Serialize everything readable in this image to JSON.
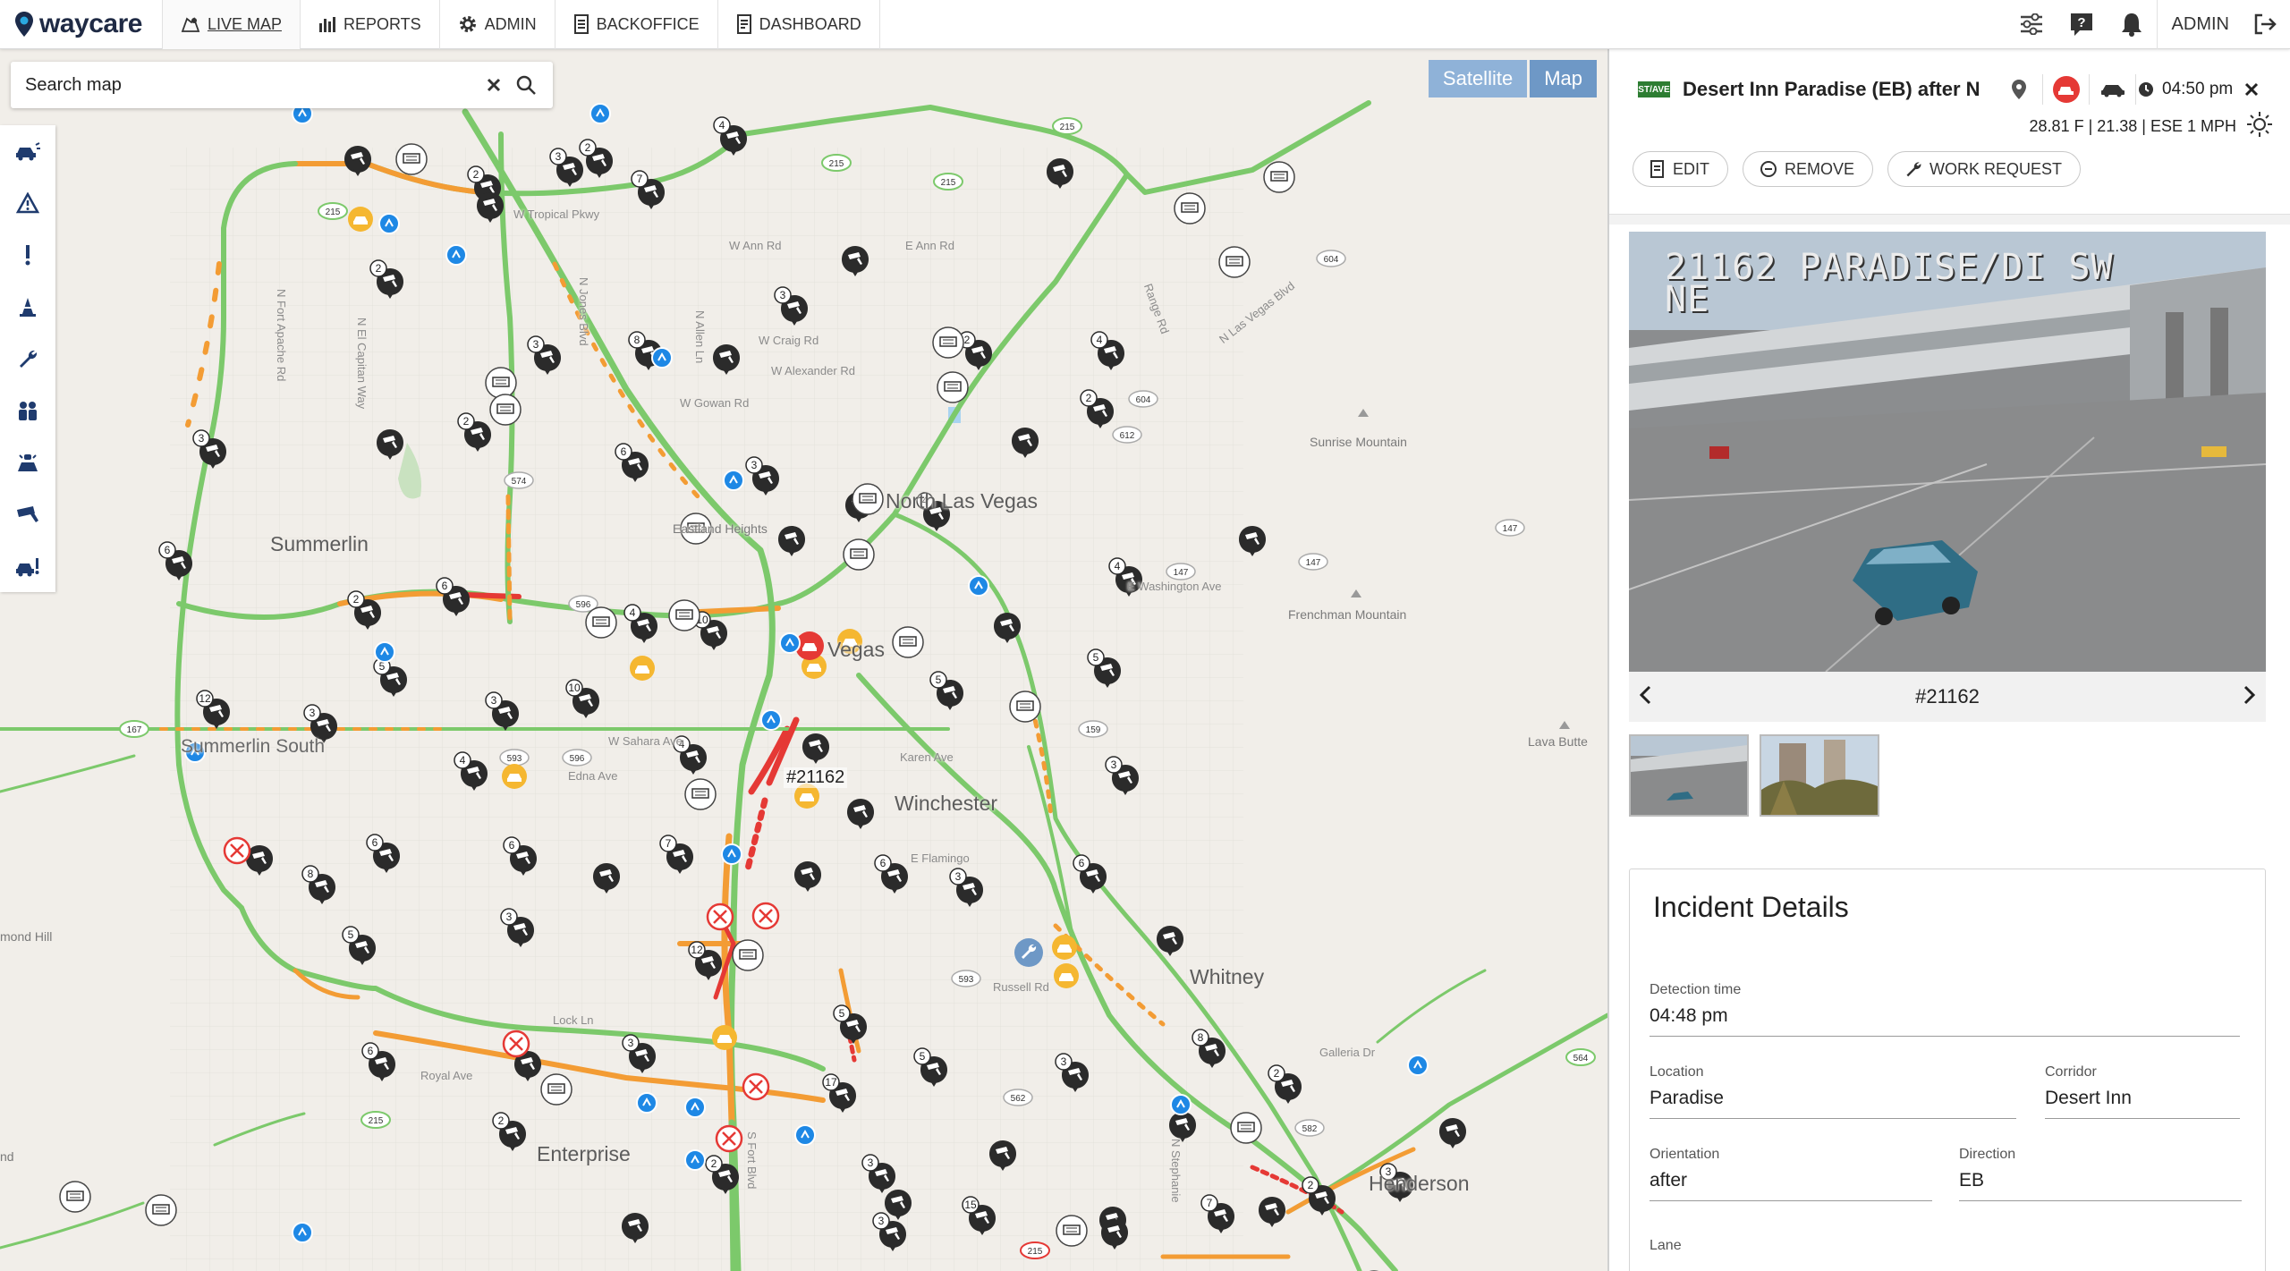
{
  "app": {
    "logo_text": "waycare",
    "nav": [
      {
        "label": "LIVE MAP",
        "icon": "live-map-icon",
        "active": true
      },
      {
        "label": "REPORTS",
        "icon": "bar-chart-icon"
      },
      {
        "label": "ADMIN",
        "icon": "gear-icon"
      },
      {
        "label": "BACKOFFICE",
        "icon": "document-icon"
      },
      {
        "label": "DASHBOARD",
        "icon": "dashboard-icon"
      }
    ],
    "user_label": "ADMIN"
  },
  "map": {
    "search_placeholder": "Search map",
    "map_types": [
      "Satellite",
      "Map"
    ],
    "selected_map_type": "Map",
    "tools": [
      "crash-layer-icon",
      "hazard-layer-icon",
      "alert-layer-icon",
      "cone-layer-icon",
      "wrench-layer-icon",
      "people-layer-icon",
      "police-layer-icon",
      "camera-layer-icon",
      "vehicle-alert-layer-icon"
    ],
    "area_labels": [
      "North Las Vegas",
      "Summerlin",
      "Summerlin South",
      "Winchester",
      "Whitney",
      "Enterprise",
      "Henderson",
      "Vegas",
      "Sunrise Mountain",
      "Frenchman Mountain",
      "Lava Butte",
      "Eastland Heights",
      "mond Hill",
      "nd"
    ],
    "street_labels": [
      "W Tropical Pkwy",
      "W Ann Rd",
      "E Ann Rd",
      "W Craig Rd",
      "W Alexander Rd",
      "W Gowan Rd",
      "N Fort Apache Rd",
      "N El Capitan Way",
      "N Jones Blvd",
      "N Allen Ln",
      "Range Rd",
      "N Las Vegas Blvd",
      "E Washington Ave",
      "W Sahara Ave",
      "Edna Ave",
      "Karen Ave",
      "Russell Rd",
      "Galleria Dr",
      "Royal Ave",
      "Lock Ln",
      "N Stephanie",
      "S Fort Blvd",
      "E Flamingo"
    ],
    "incident_tag": "#21162"
  },
  "panel": {
    "badge": "ST/AVE",
    "title": "Desert Inn Paradise (EB) after N",
    "time": "04:50 pm",
    "weather": "28.81 F | 21.38 | ESE 1 MPH",
    "actions": {
      "edit": "EDIT",
      "remove": "REMOVE",
      "work_request": "WORK REQUEST"
    },
    "camera": {
      "overlay_line1": "21162 PARADISE/DI SW",
      "overlay_line2": "NE",
      "id": "#21162"
    },
    "details": {
      "heading": "Incident Details",
      "detection_time_label": "Detection time",
      "detection_time": "04:48 pm",
      "location_label": "Location",
      "location": "Paradise",
      "corridor_label": "Corridor",
      "corridor": "Desert Inn",
      "orientation_label": "Orientation",
      "orientation": "after",
      "direction_label": "Direction",
      "direction": "EB",
      "lane_label": "Lane",
      "lane": ""
    }
  },
  "colors": {
    "accent_blue": "#1e88e5",
    "traffic_green": "#7cc96b",
    "traffic_orange": "#f39c34",
    "traffic_red": "#e53935",
    "marker_dark": "#2b2b2b",
    "marker_yellow": "#f5b731"
  }
}
